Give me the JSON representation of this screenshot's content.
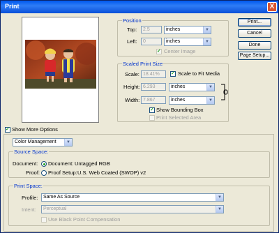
{
  "window": {
    "title": "Print",
    "close_label": "X"
  },
  "buttons": {
    "print": "Print...",
    "cancel": "Cancel",
    "done": "Done",
    "page_setup": "Page Setup..."
  },
  "position": {
    "legend": "Position",
    "top_label": "Top:",
    "top_value": "2.5",
    "top_unit": "inches",
    "left_label": "Left:",
    "left_value": "0",
    "left_unit": "inches",
    "center_label": "Center Image"
  },
  "scaled": {
    "legend": "Scaled Print Size",
    "scale_label": "Scale:",
    "scale_value": "18.41%",
    "scale_to_fit": "Scale to Fit Media",
    "height_label": "Height:",
    "height_value": "6.293",
    "height_unit": "inches",
    "width_label": "Width:",
    "width_value": "7.867",
    "width_unit": "inches",
    "bounding_box": "Show Bounding Box",
    "print_selected": "Print Selected Area"
  },
  "more_options": "Show More Options",
  "color_mgmt": {
    "selected": "Color Management"
  },
  "source": {
    "legend": "Source Space:",
    "document_label": "Document:",
    "document_radio": "Document:",
    "document_value": "Untagged RGB",
    "proof_label": "Proof:",
    "proof_radio": "Proof Setup:",
    "proof_value": "U.S. Web Coated (SWOP) v2"
  },
  "print_space": {
    "legend": "Print Space:",
    "profile_label": "Profile:",
    "profile_value": "Same As Source",
    "intent_label": "Intent:",
    "intent_value": "Perceptual",
    "bpc_label": "Use Black Point Compensation"
  }
}
